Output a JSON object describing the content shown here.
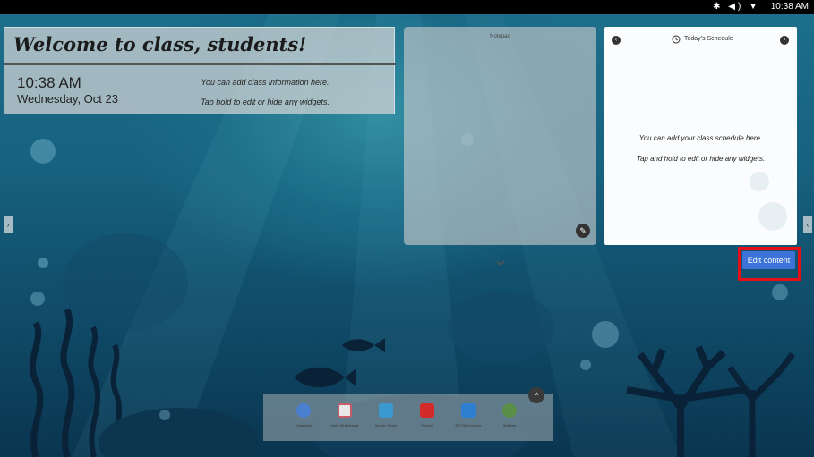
{
  "statusbar": {
    "icons": "✱ ◀) ▼",
    "time": "10:38 AM"
  },
  "welcome": {
    "title": "Welcome to class, students!",
    "clock_time": "10:38 AM",
    "clock_date": "Wednesday, Oct 23",
    "info_line_1": "You can add class information here.",
    "info_line_2": "Tap hold to edit or hide any widgets."
  },
  "notepad": {
    "title": "Notepad"
  },
  "schedule": {
    "title": "Today's Schedule",
    "text_line_1": "You can add your class schedule here.",
    "text_line_2": "Tap and hold to edit or hide any widgets."
  },
  "edit_button": {
    "label": "Edit content",
    "highlight_color": "#e3101a",
    "color": "#3b73d8"
  },
  "handles": {
    "left": "›",
    "right": "‹"
  },
  "dock": {
    "toggle": "^",
    "apps": [
      {
        "label": "Chromium",
        "icon": "chromium-icon",
        "color": "#4b7fd0"
      },
      {
        "label": "Note Whiteboard",
        "icon": "whiteboard-icon",
        "color": "#c85a6a"
      },
      {
        "label": "Screen Share",
        "icon": "screen-share-icon",
        "color": "#3a9ad0"
      },
      {
        "label": "Spinner",
        "icon": "spinner-icon",
        "color": "#d32b2b"
      },
      {
        "label": "ES File Explorer",
        "icon": "file-explorer-icon",
        "color": "#2f7fd0"
      },
      {
        "label": "Settings",
        "icon": "settings-icon",
        "color": "#5a8f48"
      }
    ]
  }
}
